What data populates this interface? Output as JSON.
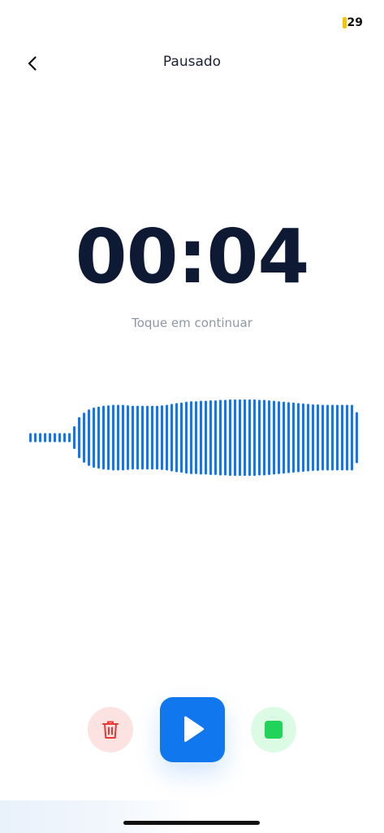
{
  "status_bar": {
    "battery_level": "29",
    "battery_color": "#f5c400"
  },
  "nav": {
    "back_icon": "chevron-left-icon",
    "title": "Pausado"
  },
  "recording": {
    "elapsed_time": "00:04",
    "hint": "Toque em continuar",
    "waveform_color": "#1177ee",
    "waveform_levels": [
      0.1,
      0.1,
      0.1,
      0.1,
      0.1,
      0.1,
      0.1,
      0.1,
      0.1,
      0.25,
      0.45,
      0.55,
      0.62,
      0.66,
      0.68,
      0.7,
      0.71,
      0.72,
      0.72,
      0.72,
      0.71,
      0.7,
      0.7,
      0.7,
      0.7,
      0.7,
      0.7,
      0.71,
      0.72,
      0.74,
      0.76,
      0.77,
      0.79,
      0.8,
      0.8,
      0.81,
      0.81,
      0.82,
      0.82,
      0.83,
      0.83,
      0.84,
      0.84,
      0.84,
      0.84,
      0.84,
      0.84,
      0.83,
      0.83,
      0.82,
      0.81,
      0.8,
      0.79,
      0.78,
      0.77,
      0.76,
      0.75,
      0.74,
      0.73,
      0.73,
      0.72,
      0.72,
      0.72,
      0.72,
      0.72,
      0.72,
      0.72,
      0.56
    ]
  },
  "controls": {
    "delete_icon": "trash-icon",
    "delete_color": "#e53935",
    "delete_bg": "#fde2e2",
    "play_icon": "play-icon",
    "play_bg": "#1177ee",
    "stop_icon": "stop-icon",
    "stop_color": "#22d35a",
    "stop_bg": "#dcfbe4"
  }
}
